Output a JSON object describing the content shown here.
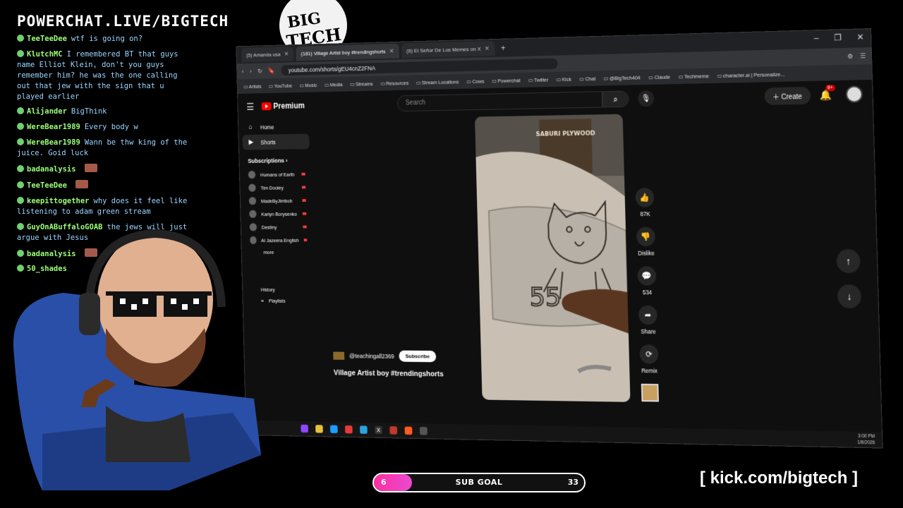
{
  "overlay": {
    "banner": "POWERCHAT.LIVE/BIGTECH",
    "logo_text_line1": "BIG",
    "logo_text_line2": "TECH",
    "kick_link": "[ kick.com/bigtech ]",
    "subgoal": {
      "label": "SUB GOAL",
      "current": "6",
      "target": "33",
      "progress_fraction": 0.18
    }
  },
  "chat": [
    {
      "name": "TeeTeeDee",
      "text": "wtf is going on?",
      "emote": false
    },
    {
      "name": "KlutchMC",
      "text": "I remembered BT that guys name Elliot Klein, don't you guys remember him? he was the one calling out that jew with the sign that u played earlier",
      "emote": false
    },
    {
      "name": "Alijander",
      "text": "BigThink",
      "emote": false
    },
    {
      "name": "WereBear1989",
      "text": "Every body w",
      "emote": false
    },
    {
      "name": "WereBear1989",
      "text": "Wann be thw king of the juice. Goid luck",
      "emote": false
    },
    {
      "name": "badanalysis",
      "text": "",
      "emote": true
    },
    {
      "name": "TeeTeeDee",
      "text": "",
      "emote": true
    },
    {
      "name": "keepittogether",
      "text": "why does it feel like listening to adam green stream",
      "emote": false
    },
    {
      "name": "GuyOnABuffaloGOAB",
      "text": "the jews will just argue with Jesus",
      "emote": false
    },
    {
      "name": "badanalysis",
      "text": "",
      "emote": true
    },
    {
      "name": "50_shades",
      "text": "",
      "emote": false
    }
  ],
  "browser": {
    "tabs": [
      {
        "label": "(5) Amanda usa",
        "active": false
      },
      {
        "label": "(181) Village Artist boy #trendingshorts",
        "active": true
      },
      {
        "label": "(6) El Señor De Los Memes on X",
        "active": false
      }
    ],
    "new_tab": "+",
    "url": "youtube.com/shorts/gEU4cnZ2FNA",
    "bookmarks": [
      "Artists",
      "YouTube",
      "Music",
      "Media",
      "Streams",
      "Resources",
      "Stream Locations",
      "Cows",
      "Powerchat",
      "Twitter",
      "Kick",
      "Chat",
      "@BigTech404",
      "Claude",
      "Techmeme",
      "character.ai | Personalize..."
    ]
  },
  "youtube": {
    "logo": "Premium",
    "search_placeholder": "Search",
    "create": "Create",
    "notif_count": "9+",
    "nav": [
      {
        "label": "Home",
        "icon": "home-icon"
      },
      {
        "label": "Shorts",
        "icon": "shorts-icon"
      }
    ],
    "subscriptions_title": "Subscriptions",
    "subscriptions": [
      "Humans of Earth",
      "Tim Dooley",
      "MadeByJimbob",
      "Karlyn Borysenko",
      "Destiny",
      "Al Jazeera English"
    ],
    "more_label": "more",
    "history_label": "History",
    "playlists_label": "Playlists",
    "short": {
      "channel": "@teachingall2369",
      "subscribe": "Subscribe",
      "title": "Village Artist boy #trendingshorts",
      "shop_sign": "SABURI PLYWOOD",
      "drawn_number": "55"
    },
    "actions": {
      "likes": "87K",
      "dislike": "Dislike",
      "comments": "534",
      "share": "Share",
      "remix": "Remix"
    }
  },
  "taskbar": {
    "time": "3:00 PM",
    "date": "1/8/2026"
  }
}
